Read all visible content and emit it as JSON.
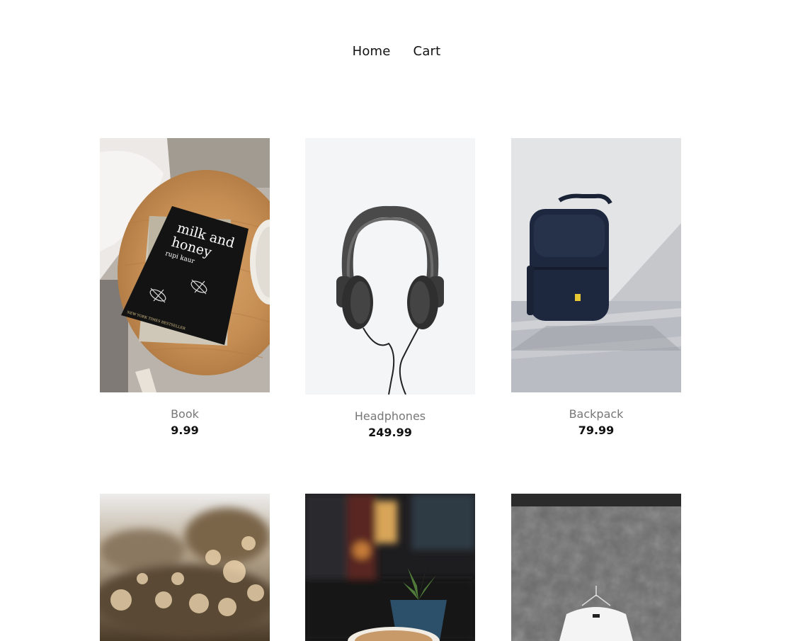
{
  "nav": {
    "home": "Home",
    "cart": "Cart"
  },
  "products": [
    {
      "name": "Book",
      "price": "9.99",
      "image": "book"
    },
    {
      "name": "Headphones",
      "price": "249.99",
      "image": "headphones"
    },
    {
      "name": "Backpack",
      "price": "79.99",
      "image": "backpack"
    },
    {
      "name": "",
      "price": "",
      "image": "bokeh-trees"
    },
    {
      "name": "",
      "price": "",
      "image": "coffee-plant"
    },
    {
      "name": "",
      "price": "",
      "image": "tshirt-on-wall"
    }
  ],
  "book_cover": {
    "title_line1": "milk and",
    "title_line2": "honey",
    "author": "rupi kaur",
    "tagline": "NEW YORK TIMES BESTSELLER"
  }
}
